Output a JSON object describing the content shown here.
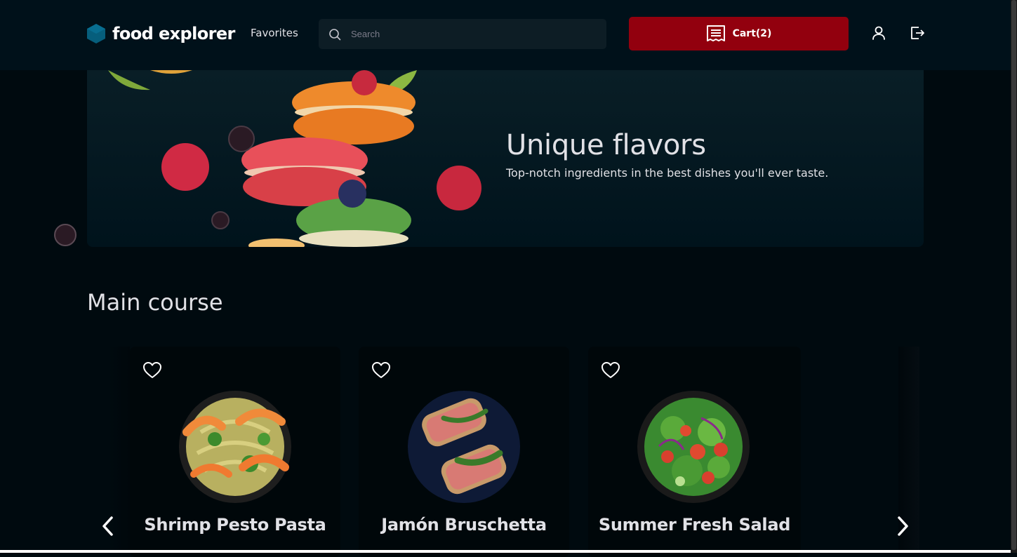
{
  "header": {
    "logo_text": "food explorer",
    "favorites_label": "Favorites",
    "search_placeholder": "Search",
    "cart_label": "Cart(2)"
  },
  "banner": {
    "title": "Unique flavors",
    "subtitle": "Top-notch ingredients in the best dishes you'll ever taste."
  },
  "section": {
    "title": "Main course",
    "dishes": [
      {
        "name": "Shrimp Pesto Pasta"
      },
      {
        "name": "Jamón Bruschetta"
      },
      {
        "name": "Summer Fresh Salad"
      }
    ]
  },
  "colors": {
    "background": "#000a0f",
    "header": "#00111a",
    "accent": "#92000e",
    "logo": "#065e7c",
    "text": "#e1e1e6"
  },
  "icons": [
    "hexagon-logo-icon",
    "search-icon",
    "receipt-icon",
    "user-icon",
    "sign-out-icon",
    "heart-icon",
    "chevron-left-icon",
    "chevron-right-icon"
  ]
}
